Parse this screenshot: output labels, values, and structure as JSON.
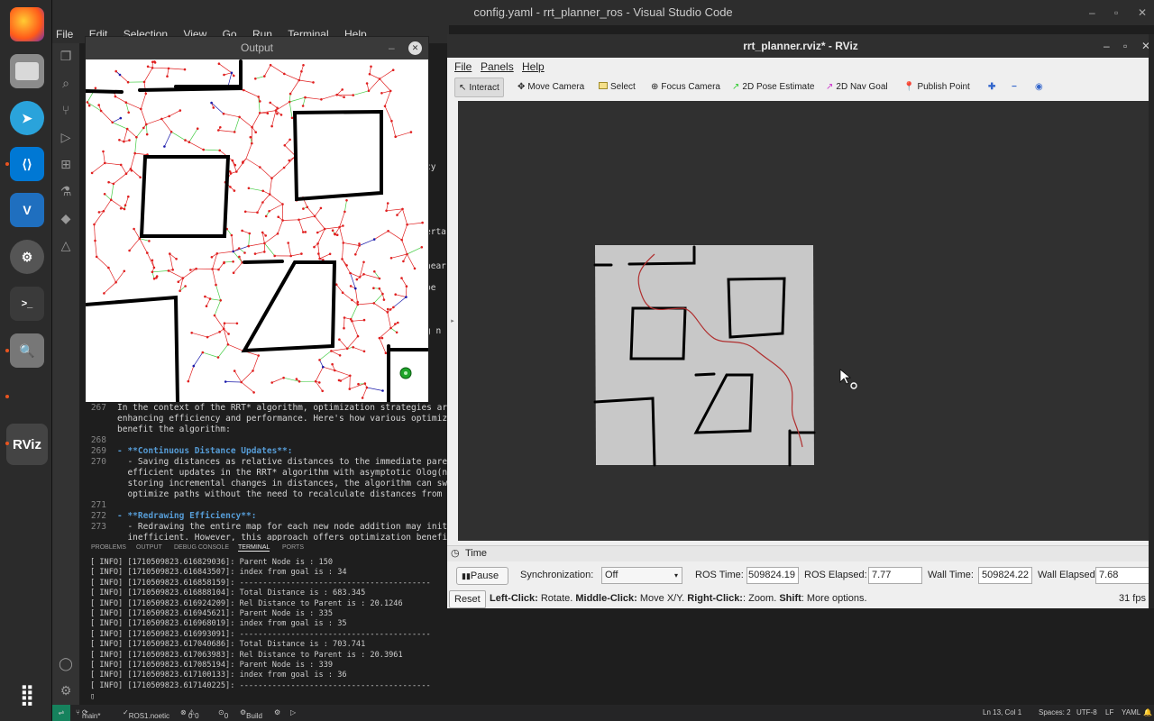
{
  "vscode": {
    "title": "config.yaml - rrt_planner_ros - Visual Studio Code",
    "menu": [
      "File",
      "Edit",
      "Selection",
      "View",
      "Go",
      "Run",
      "Terminal",
      "Help"
    ],
    "editor_lines": [
      {
        "num": "267",
        "text": "In the context of the RRT* algorithm, optimization strategies are cru"
      },
      {
        "num": "",
        "text": "enhancing efficiency and performance. Here's how various optimization"
      },
      {
        "num": "",
        "text": "benefit the algorithm:"
      },
      {
        "num": "268",
        "text": ""
      },
      {
        "num": "269",
        "text": "- **Continuous Distance Updates**:"
      },
      {
        "num": "270",
        "text": "  - Saving distances as relative distances to the immediate parent no"
      },
      {
        "num": "",
        "text": "  efficient updates in the RRT* algorithm with asymptotic Olog(n) tim"
      },
      {
        "num": "",
        "text": "  storing incremental changes in distances, the algorithm can swiftly"
      },
      {
        "num": "",
        "text": "  optimize paths without the need to recalculate distances from scrat"
      },
      {
        "num": "271",
        "text": ""
      },
      {
        "num": "272",
        "text": "- **Redrawing Efficiency**:"
      },
      {
        "num": "273",
        "text": "  - Redrawing the entire map for each new node addition may initially"
      },
      {
        "num": "",
        "text": "  inefficient. However, this approach offers optimization benefits in"
      }
    ],
    "side_fragments": [
      "cy",
      "erta",
      "hear",
      "be",
      "g n"
    ],
    "panel_tabs": [
      "PROBLEMS",
      "OUTPUT",
      "DEBUG CONSOLE",
      "TERMINAL",
      "PORTS"
    ],
    "terminal_lines": [
      "[ INFO] [1710509823.616829036]: Parent Node is : 150",
      "[ INFO] [1710509823.616843507]: index from goal is : 34",
      "[ INFO] [1710509823.616858159]: -----------------------------------------",
      "[ INFO] [1710509823.616888104]: Total Distance is : 683.345",
      "[ INFO] [1710509823.616924209]: Rel Distance to Parent is : 20.1246",
      "[ INFO] [1710509823.616945621]: Parent Node is : 335",
      "[ INFO] [1710509823.616968019]: index from goal is : 35",
      "[ INFO] [1710509823.616993091]: -----------------------------------------",
      "[ INFO] [1710509823.617040686]: Total Distance is : 703.741",
      "[ INFO] [1710509823.617063983]: Rel Distance to Parent is : 20.3961",
      "[ INFO] [1710509823.617085194]: Parent Node is : 339",
      "[ INFO] [1710509823.617100133]: index from goal is : 36",
      "[ INFO] [1710509823.617140225]: -----------------------------------------"
    ],
    "status": {
      "branch": "main*",
      "ros": "ROS1.noetic",
      "errors": "0",
      "warnings": "0",
      "ports": "0",
      "build": "Build",
      "position": "Ln 13, Col 1",
      "spaces": "Spaces: 2",
      "encoding": "UTF-8",
      "eol": "LF",
      "language": "YAML"
    }
  },
  "output_window": {
    "title": "Output"
  },
  "rviz": {
    "title": "rrt_planner.rviz* - RViz",
    "menu": [
      "File",
      "Panels",
      "Help"
    ],
    "tools": [
      {
        "label": "Interact",
        "icon": "pointer-icon"
      },
      {
        "label": "Move Camera",
        "icon": "move-icon"
      },
      {
        "label": "Select",
        "icon": "select-icon"
      },
      {
        "label": "Focus Camera",
        "icon": "focus-icon"
      },
      {
        "label": "2D Pose Estimate",
        "icon": "pose-arrow-icon"
      },
      {
        "label": "2D Nav Goal",
        "icon": "goal-arrow-icon"
      },
      {
        "label": "Publish Point",
        "icon": "pin-icon"
      }
    ],
    "time_panel": {
      "title": "Time",
      "pause_label": "Pause",
      "sync_label": "Synchronization:",
      "sync_value": "Off",
      "ros_time_label": "ROS Time:",
      "ros_time_value": "509824.19",
      "ros_elapsed_label": "ROS Elapsed:",
      "ros_elapsed_value": "7.77",
      "wall_time_label": "Wall Time:",
      "wall_time_value": "509824.22",
      "wall_elapsed_label": "Wall Elapsed:",
      "wall_elapsed_value": "7.68",
      "reset_label": "Reset",
      "hint_left": "Left-Click:",
      "hint_left_text": " Rotate. ",
      "hint_middle": "Middle-Click:",
      "hint_middle_text": " Move X/Y. ",
      "hint_right": "Right-Click:",
      "hint_right_text": ": Zoom. ",
      "hint_shift": "Shift",
      "hint_shift_text": ": More options.",
      "fps": "31 fps"
    }
  },
  "dock": {
    "apps": [
      "firefox-icon",
      "files-icon",
      "telegram-icon",
      "vscode-icon",
      "vnc-icon",
      "settings-icon",
      "terminal-icon",
      "search-app-icon",
      "rviz-app-icon",
      "app-grid-icon"
    ],
    "rviz_label": "RViz"
  },
  "colors": {
    "tree_edges": "#e02020",
    "rewired_edges": "#44cc44",
    "path": "#1a1aaa",
    "obstacles": "#000000",
    "goal": "#22aa22",
    "rviz_map": "#c8c8c8",
    "rviz_path": "#b03030"
  }
}
